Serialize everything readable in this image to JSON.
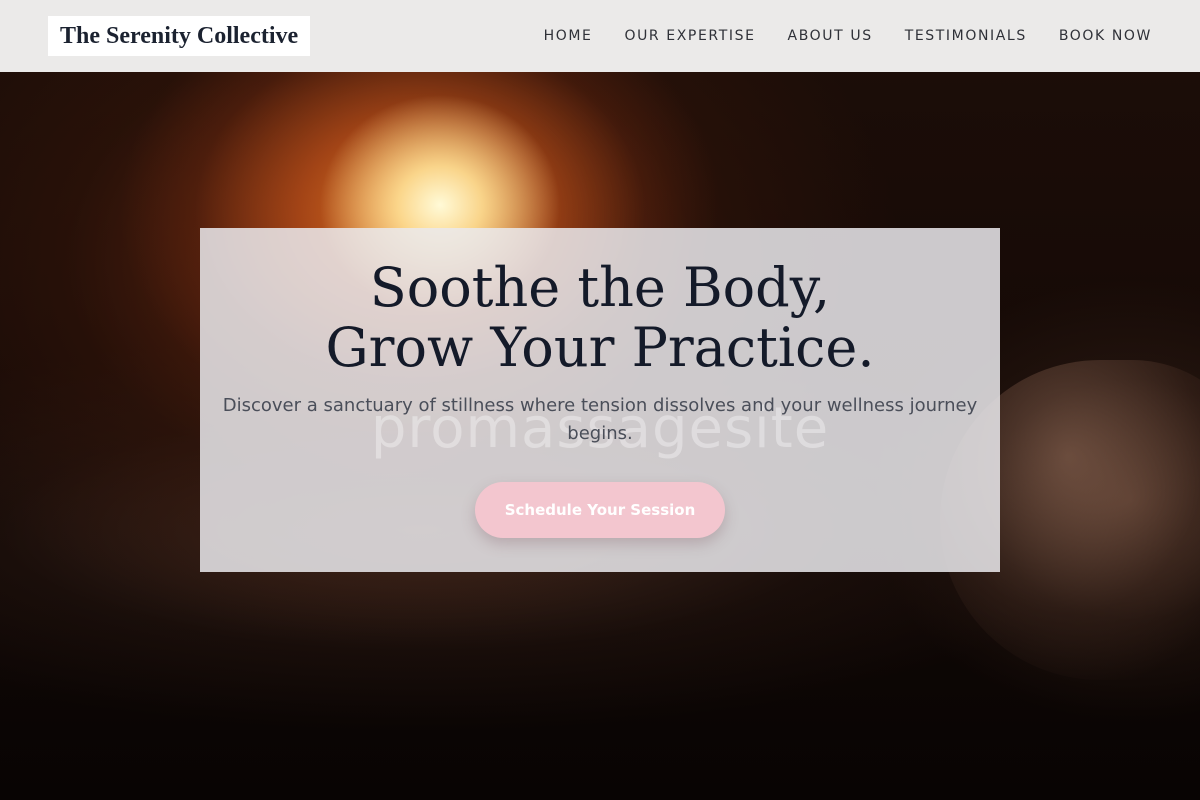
{
  "header": {
    "logo": "The Serenity Collective",
    "nav": [
      {
        "label": "HOME"
      },
      {
        "label": "OUR EXPERTISE"
      },
      {
        "label": "ABOUT US"
      },
      {
        "label": "TESTIMONIALS"
      },
      {
        "label": "BOOK NOW"
      }
    ]
  },
  "hero": {
    "headline_line1": "Soothe the Body,",
    "headline_line2": "Grow Your Practice.",
    "subtext": "Discover a sanctuary of stillness where tension dissolves and your wellness journey begins.",
    "cta": "Schedule Your Session",
    "watermark": "promassagesite"
  },
  "colors": {
    "header_bg": "#ebeae9",
    "heading_text": "#141a29",
    "cta_bg": "#f3c6cf",
    "cta_text": "#ffffff"
  }
}
